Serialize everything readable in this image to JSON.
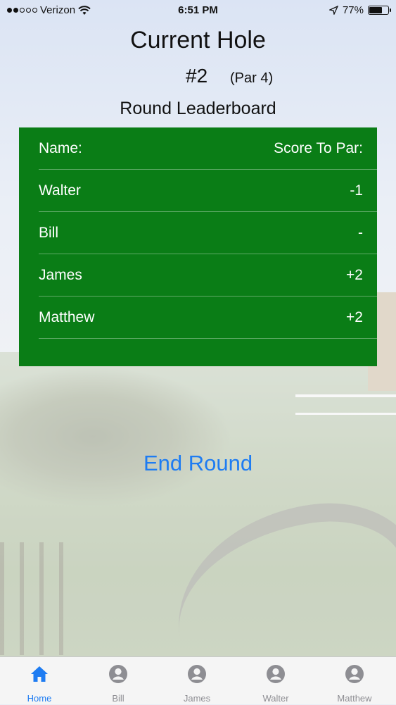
{
  "status_bar": {
    "carrier": "Verizon",
    "time": "6:51 PM",
    "battery": "77%",
    "battery_level": 0.77,
    "signal_bars": 2,
    "icons": [
      "wifi-icon",
      "location-icon",
      "battery-icon"
    ]
  },
  "header": {
    "title": "Current Hole",
    "hole_number": "#2",
    "par": "(Par 4)",
    "leaderboard_title": "Round Leaderboard"
  },
  "leaderboard": {
    "header": {
      "name": "Name:",
      "score": "Score To Par:"
    },
    "rows": [
      {
        "name": "Walter",
        "score": "-1"
      },
      {
        "name": "Bill",
        "score": "-"
      },
      {
        "name": "James",
        "score": "+2"
      },
      {
        "name": "Matthew",
        "score": "+2"
      }
    ]
  },
  "actions": {
    "end_round": "End Round"
  },
  "tabs": [
    {
      "label": "Home",
      "icon": "home-icon",
      "active": true
    },
    {
      "label": "Bill",
      "icon": "person-icon",
      "active": false
    },
    {
      "label": "James",
      "icon": "person-icon",
      "active": false
    },
    {
      "label": "Walter",
      "icon": "person-icon",
      "active": false
    },
    {
      "label": "Matthew",
      "icon": "person-icon",
      "active": false
    }
  ],
  "colors": {
    "accent": "#1e7cf2",
    "board": "#0a7d16",
    "tab_inactive": "#8e8e93"
  }
}
